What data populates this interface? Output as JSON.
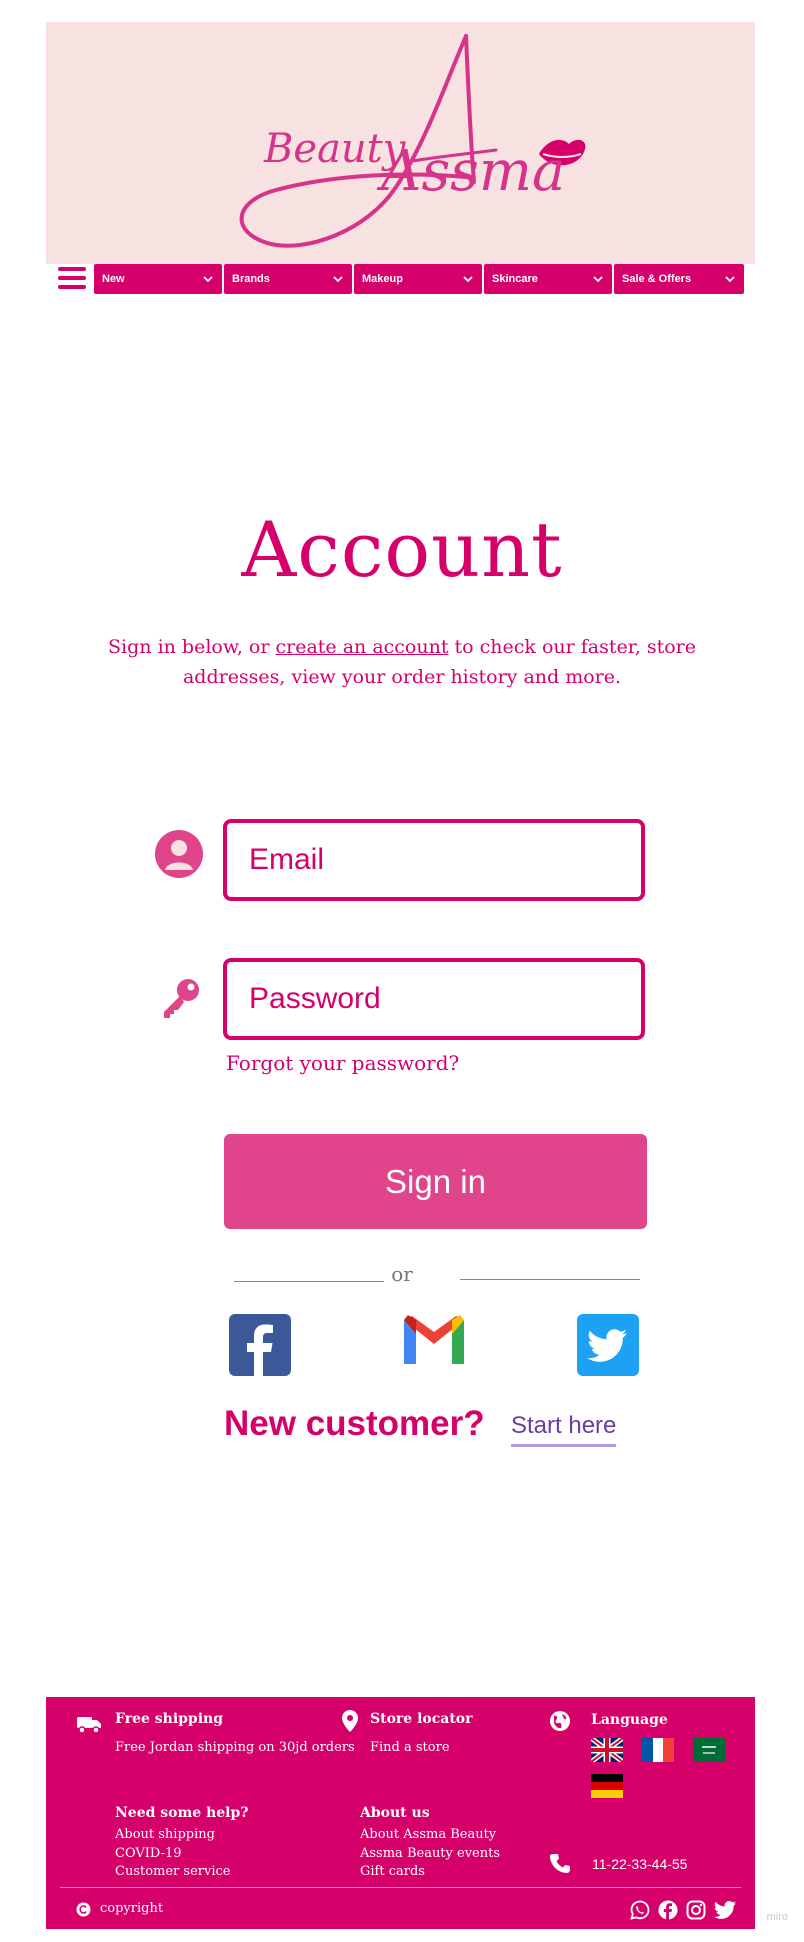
{
  "brand": {
    "logo_small_text": "Beauty",
    "logo_large_text": "Assma"
  },
  "nav": {
    "items": [
      {
        "label": "New"
      },
      {
        "label": "Brands"
      },
      {
        "label": "Makeup"
      },
      {
        "label": "Skincare"
      },
      {
        "label": "Sale & Offers"
      }
    ]
  },
  "account": {
    "title": "Account",
    "intro_before": "Sign in below, or ",
    "intro_link": "create an account",
    "intro_after": " to check our faster, store addresses, view your order history and more.",
    "email_placeholder": "Email",
    "password_placeholder": "Password",
    "forgot_label": "Forgot your password?",
    "signin_label": "Sign in",
    "or_label": "or",
    "new_customer_label": "New customer?",
    "start_here_label": "Start here"
  },
  "social": [
    {
      "name": "facebook-login-icon"
    },
    {
      "name": "gmail-login-icon"
    },
    {
      "name": "twitter-login-icon"
    }
  ],
  "footer": {
    "shipping_title": "Free shipping",
    "shipping_text": "Free Jordan shipping on 30jd orders",
    "store_title": "Store locator",
    "store_link": "Find a store",
    "language_title": "Language",
    "help_title": "Need some help?",
    "help_links": [
      "About shipping",
      "COVID-19",
      "Customer service"
    ],
    "about_title": "About us",
    "about_links": [
      "About Assma Beauty",
      "Assma Beauty events",
      "Gift cards"
    ],
    "phone": "11-22-33-44-55",
    "copyright": "copyright"
  },
  "watermark": "miro",
  "colors": {
    "primary": "#d6006b",
    "header_bg": "#f8e1e1",
    "signin_bg": "#e0448a",
    "start_here": "#6a3ea1"
  }
}
